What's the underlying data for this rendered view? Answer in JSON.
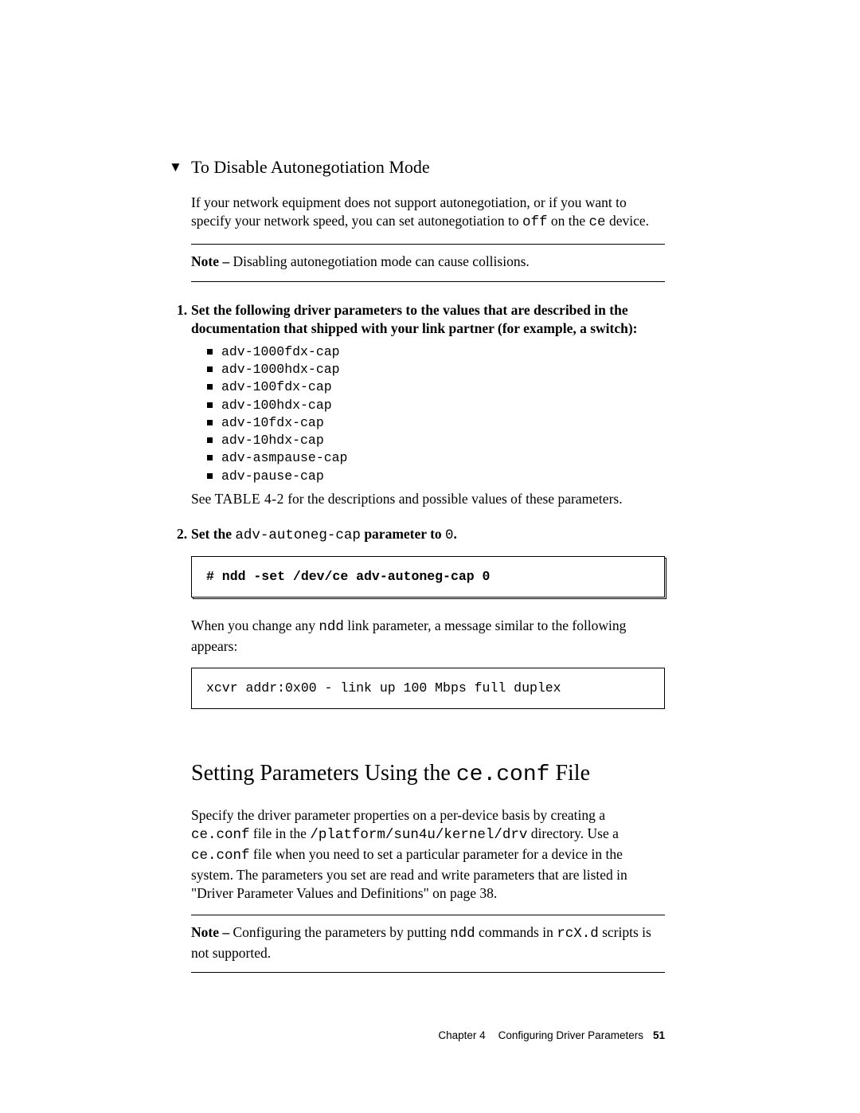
{
  "section1": {
    "marker": "▼",
    "title": "To Disable Autonegotiation Mode",
    "intro_pre": "If your network equipment does not support autonegotiation, or if you want to specify your network speed, you can set autonegotiation to ",
    "intro_code1": "off",
    "intro_mid": " on the ",
    "intro_code2": "ce",
    "intro_post": " device.",
    "note_label": "Note –",
    "note_text": " Disabling autonegotiation mode can cause collisions.",
    "step1_num": "1.",
    "step1_text": "Set the following driver parameters to the values that are described in the documentation that shipped with your link partner (for example, a switch):",
    "params": [
      "adv-1000fdx-cap",
      "adv-1000hdx-cap",
      "adv-100fdx-cap",
      "adv-100hdx-cap",
      "adv-10fdx-cap",
      "adv-10hdx-cap",
      "adv-asmpause-cap",
      "adv-pause-cap"
    ],
    "after_list_pre": "See ",
    "after_list_ref": "TABLE 4-2",
    "after_list_post": " for the descriptions and possible values of these parameters.",
    "step2_num": "2.",
    "step2_pre": "Set the ",
    "step2_code": "adv-autoneg-cap",
    "step2_mid": " parameter to ",
    "step2_val": "0",
    "step2_post": ".",
    "cmd_box": "# ndd -set /dev/ce adv-autoneg-cap 0",
    "change_pre": "When you change any ",
    "change_code": "ndd",
    "change_post": " link parameter, a message similar to the following appears:",
    "output_box": "xcvr addr:0x00 - link up 100 Mbps full duplex"
  },
  "section2": {
    "title_pre": "Setting Parameters Using the ",
    "title_code": "ce.conf",
    "title_post": " File",
    "p1_a": "Specify the driver parameter properties on a per-device basis by creating a ",
    "p1_code1": "ce.conf",
    "p1_b": " file in the ",
    "p1_code2": "/platform/sun4u/kernel/drv",
    "p1_c": " directory. Use a ",
    "p1_code3": "ce.conf",
    "p1_d": " file when you need to set a particular parameter for a device in the system. The parameters you set are read and write parameters that are listed in \"Driver Parameter Values and Definitions\" on page 38.",
    "note_label": "Note –",
    "note_a": " Configuring the parameters by putting ",
    "note_code1": "ndd",
    "note_b": " commands in ",
    "note_code2": "rcX.d",
    "note_c": " scripts is not supported."
  },
  "footer": {
    "chapter": "Chapter 4",
    "title": "Configuring Driver Parameters",
    "page": "51"
  }
}
